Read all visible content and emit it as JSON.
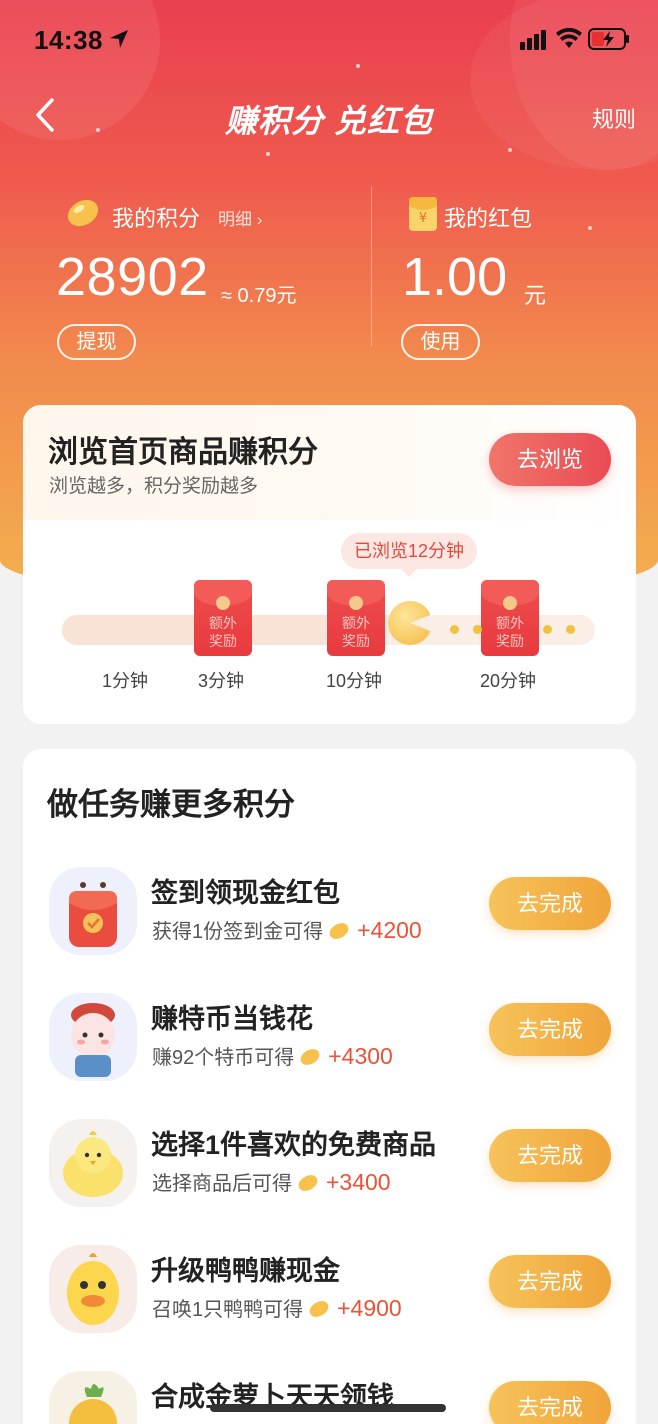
{
  "status_bar": {
    "time": "14:38"
  },
  "navbar": {
    "title": "赚积分 兑红包",
    "rules": "规则"
  },
  "points": {
    "label": "我的积分",
    "detail_link": "明细 ›",
    "value": "28902",
    "approx": "≈ 0.79元",
    "withdraw_label": "提现"
  },
  "redpack": {
    "label": "我的红包",
    "value": "1.00",
    "unit": "元",
    "use_label": "使用"
  },
  "browse_card": {
    "title": "浏览首页商品赚积分",
    "subtitle": "浏览越多，积分奖励越多",
    "button": "去浏览",
    "browsed_badge": "已浏览12分钟",
    "progress_fraction": 0.6,
    "milestone_text": [
      "额外",
      "奖励"
    ],
    "ticks": [
      "1分钟",
      "3分钟",
      "10分钟",
      "20分钟"
    ]
  },
  "tasks": {
    "title": "做任务赚更多积分",
    "items": [
      {
        "title": "签到领现金红包",
        "desc": "获得1份签到金可得",
        "reward": "+4200",
        "button": "去完成",
        "icon": "redpack-sign-in-icon"
      },
      {
        "title": "赚特币当钱花",
        "desc": "赚92个特币可得",
        "reward": "+4300",
        "button": "去完成",
        "icon": "cat-mascot-icon"
      },
      {
        "title": "选择1件喜欢的免费商品",
        "desc": "选择商品后可得",
        "reward": "+3400",
        "button": "去完成",
        "icon": "chick-mascot-icon"
      },
      {
        "title": "升级鸭鸭赚现金",
        "desc": "召唤1只鸭鸭可得",
        "reward": "+4900",
        "button": "去完成",
        "icon": "duck-mascot-icon"
      },
      {
        "title": "合成金萝卜天天领钱",
        "desc": "",
        "reward": "",
        "button": "去完成",
        "icon": "golden-radish-icon"
      }
    ]
  },
  "colors": {
    "primary_red": "#ea4b55",
    "accent_orange": "#f0a43a",
    "reward_text": "#ec5238"
  }
}
